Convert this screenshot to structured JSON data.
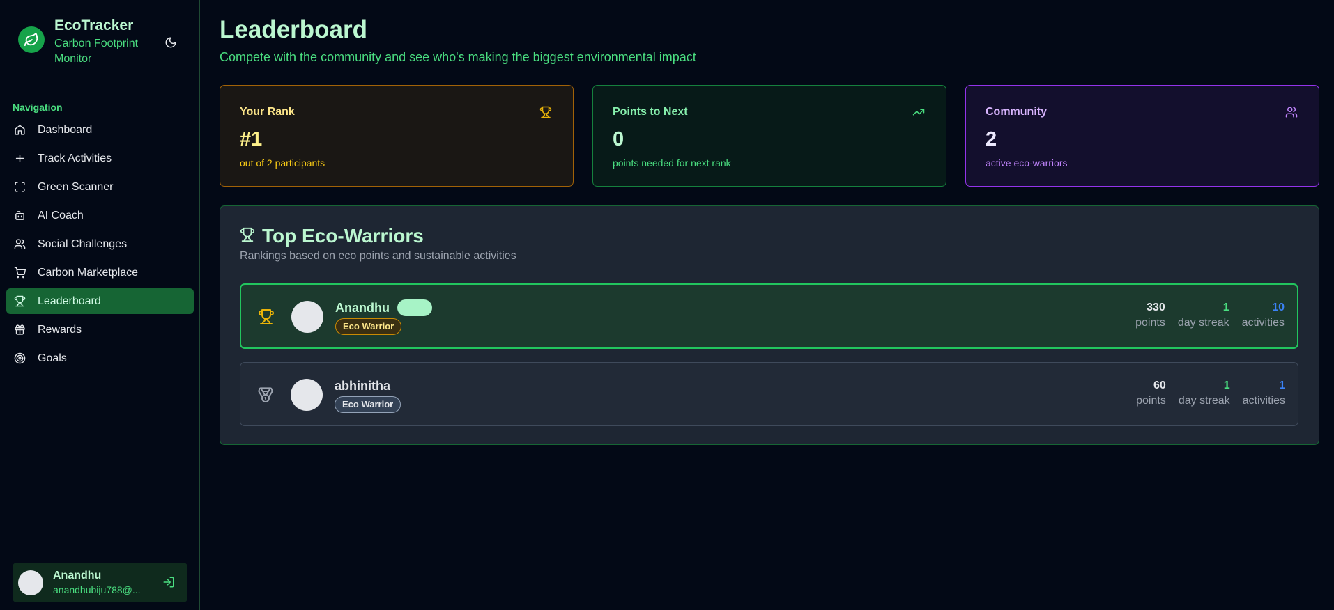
{
  "app": {
    "name": "EcoTracker",
    "subtitle": "Carbon Footprint Monitor"
  },
  "sidebar": {
    "section_label": "Navigation",
    "items": [
      {
        "label": "Dashboard",
        "icon": "home-icon"
      },
      {
        "label": "Track Activities",
        "icon": "plus-icon"
      },
      {
        "label": "Green Scanner",
        "icon": "scan-icon"
      },
      {
        "label": "AI Coach",
        "icon": "bot-icon"
      },
      {
        "label": "Social Challenges",
        "icon": "users-icon"
      },
      {
        "label": "Carbon Marketplace",
        "icon": "cart-icon"
      },
      {
        "label": "Leaderboard",
        "icon": "trophy-icon",
        "active": true
      },
      {
        "label": "Rewards",
        "icon": "gift-icon"
      },
      {
        "label": "Goals",
        "icon": "target-icon"
      }
    ],
    "user": {
      "name": "Anandhu",
      "email": "anandhubiju788@..."
    }
  },
  "header": {
    "title": "Leaderboard",
    "subtitle": "Compete with the community and see who's making the biggest environmental impact"
  },
  "stats": {
    "rank": {
      "label": "Your Rank",
      "value": "#1",
      "desc": "out of 2 participants",
      "icon": "trophy-icon"
    },
    "points_to_next": {
      "label": "Points to Next",
      "value": "0",
      "desc": "points needed for next rank",
      "icon": "trending-up-icon"
    },
    "community": {
      "label": "Community",
      "value": "2",
      "desc": "active eco-warriors",
      "icon": "users-icon"
    }
  },
  "board": {
    "title": "Top Eco-Warriors",
    "subtitle": "Rankings based on eco points and sustainable activities",
    "rows": [
      {
        "name": "Anandhu",
        "badge": "Eco Warrior",
        "points": "330",
        "points_label": "points",
        "streak": "1",
        "streak_label": "day streak",
        "activities": "10",
        "activities_label": "activities",
        "rank_icon": "trophy-icon"
      },
      {
        "name": "abhinitha",
        "badge": "Eco Warrior",
        "points": "60",
        "points_label": "points",
        "streak": "1",
        "streak_label": "day streak",
        "activities": "1",
        "activities_label": "activities",
        "rank_icon": "medal-icon"
      }
    ]
  },
  "colors": {
    "accent": "#16a34a",
    "background": "#030916",
    "rank_accent": "#eab308",
    "community_accent": "#9333ea"
  }
}
